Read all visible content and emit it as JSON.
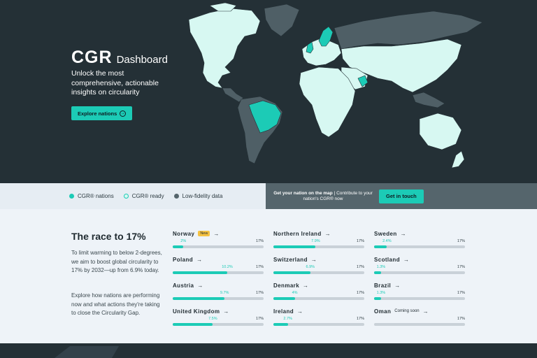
{
  "brand": {
    "mark": "CGR",
    "suffix": "Dashboard"
  },
  "hero": {
    "tagline": "Unlock the most comprehensive, actionable insights on circularity",
    "cta_label": "Explore nations"
  },
  "legend": [
    {
      "label": "CGR® nations",
      "kind": "teal"
    },
    {
      "label": "CGR® ready",
      "kind": "ready"
    },
    {
      "label": "Low-fidelity data",
      "kind": "low"
    }
  ],
  "contribute": {
    "lead": "Get your nation on the map",
    "rest": " | Contribute to your nation's CGR® now",
    "button_label": "Get in touch"
  },
  "race": {
    "title": "The race to 17%",
    "p1": "To limit warming to below 2-degrees, we aim to boost global circularity to 17% by 2032—up from 6.9% today.",
    "p2": "Explore how nations are performing now and what actions they're taking to close the Circularity Gap."
  },
  "target_label": "17%",
  "target_value": 17,
  "nations": [
    {
      "name": "Norway",
      "value": 2,
      "value_label": "2%",
      "badge": "New"
    },
    {
      "name": "Poland",
      "value": 10.2,
      "value_label": "10.2%"
    },
    {
      "name": "Austria",
      "value": 9.7,
      "value_label": "9.7%"
    },
    {
      "name": "United Kingdom",
      "value": 7.5,
      "value_label": "7.5%"
    },
    {
      "name": "Northern Ireland",
      "value": 7.9,
      "value_label": "7.9%"
    },
    {
      "name": "Switzerland",
      "value": 6.9,
      "value_label": "6.9%"
    },
    {
      "name": "Denmark",
      "value": 4,
      "value_label": "4%"
    },
    {
      "name": "Ireland",
      "value": 2.7,
      "value_label": "2.7%"
    },
    {
      "name": "Sweden",
      "value": 2.4,
      "value_label": "2.4%"
    },
    {
      "name": "Scotland",
      "value": 1.3,
      "value_label": "1.3%"
    },
    {
      "name": "Brazil",
      "value": 1.3,
      "value_label": "1.3%"
    },
    {
      "name": "Oman",
      "value": 0,
      "value_label": "",
      "coming": "Coming soon"
    }
  ],
  "colors": {
    "teal": "#1ccbb6",
    "ready": "#d7f8f2",
    "low": "#55656c",
    "dark": "#243036"
  }
}
